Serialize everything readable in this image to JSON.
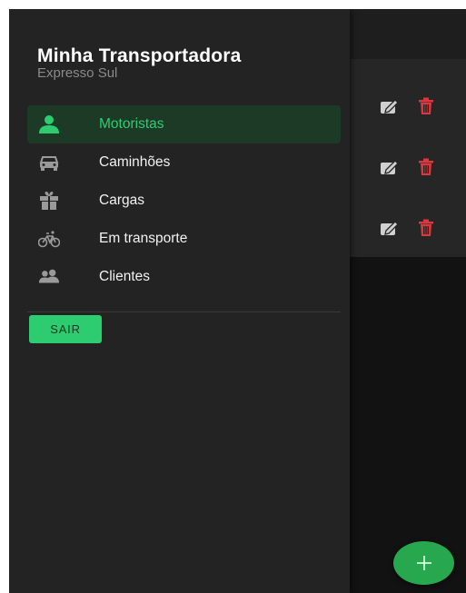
{
  "drawer": {
    "title": "Minha Transportadora",
    "subtitle": "Expresso Sul",
    "items": [
      {
        "label": "Motoristas",
        "icon": "person-icon",
        "active": true
      },
      {
        "label": "Caminhões",
        "icon": "car-icon",
        "active": false
      },
      {
        "label": "Cargas",
        "icon": "gift-icon",
        "active": false
      },
      {
        "label": "Em transporte",
        "icon": "bicycle-icon",
        "active": false
      },
      {
        "label": "Clientes",
        "icon": "people-icon",
        "active": false
      }
    ],
    "logout_label": "SAIR"
  },
  "list": {
    "rows": [
      {
        "actions": [
          "edit-icon",
          "delete-icon"
        ]
      },
      {
        "actions": [
          "edit-icon",
          "delete-icon"
        ]
      },
      {
        "actions": [
          "edit-icon",
          "delete-icon"
        ]
      }
    ]
  },
  "fab": {
    "label": "+"
  },
  "colors": {
    "accent": "#2ecc71",
    "danger": "#d9383f",
    "drawer_bg": "#232323",
    "active_bg": "#1c3a26"
  }
}
